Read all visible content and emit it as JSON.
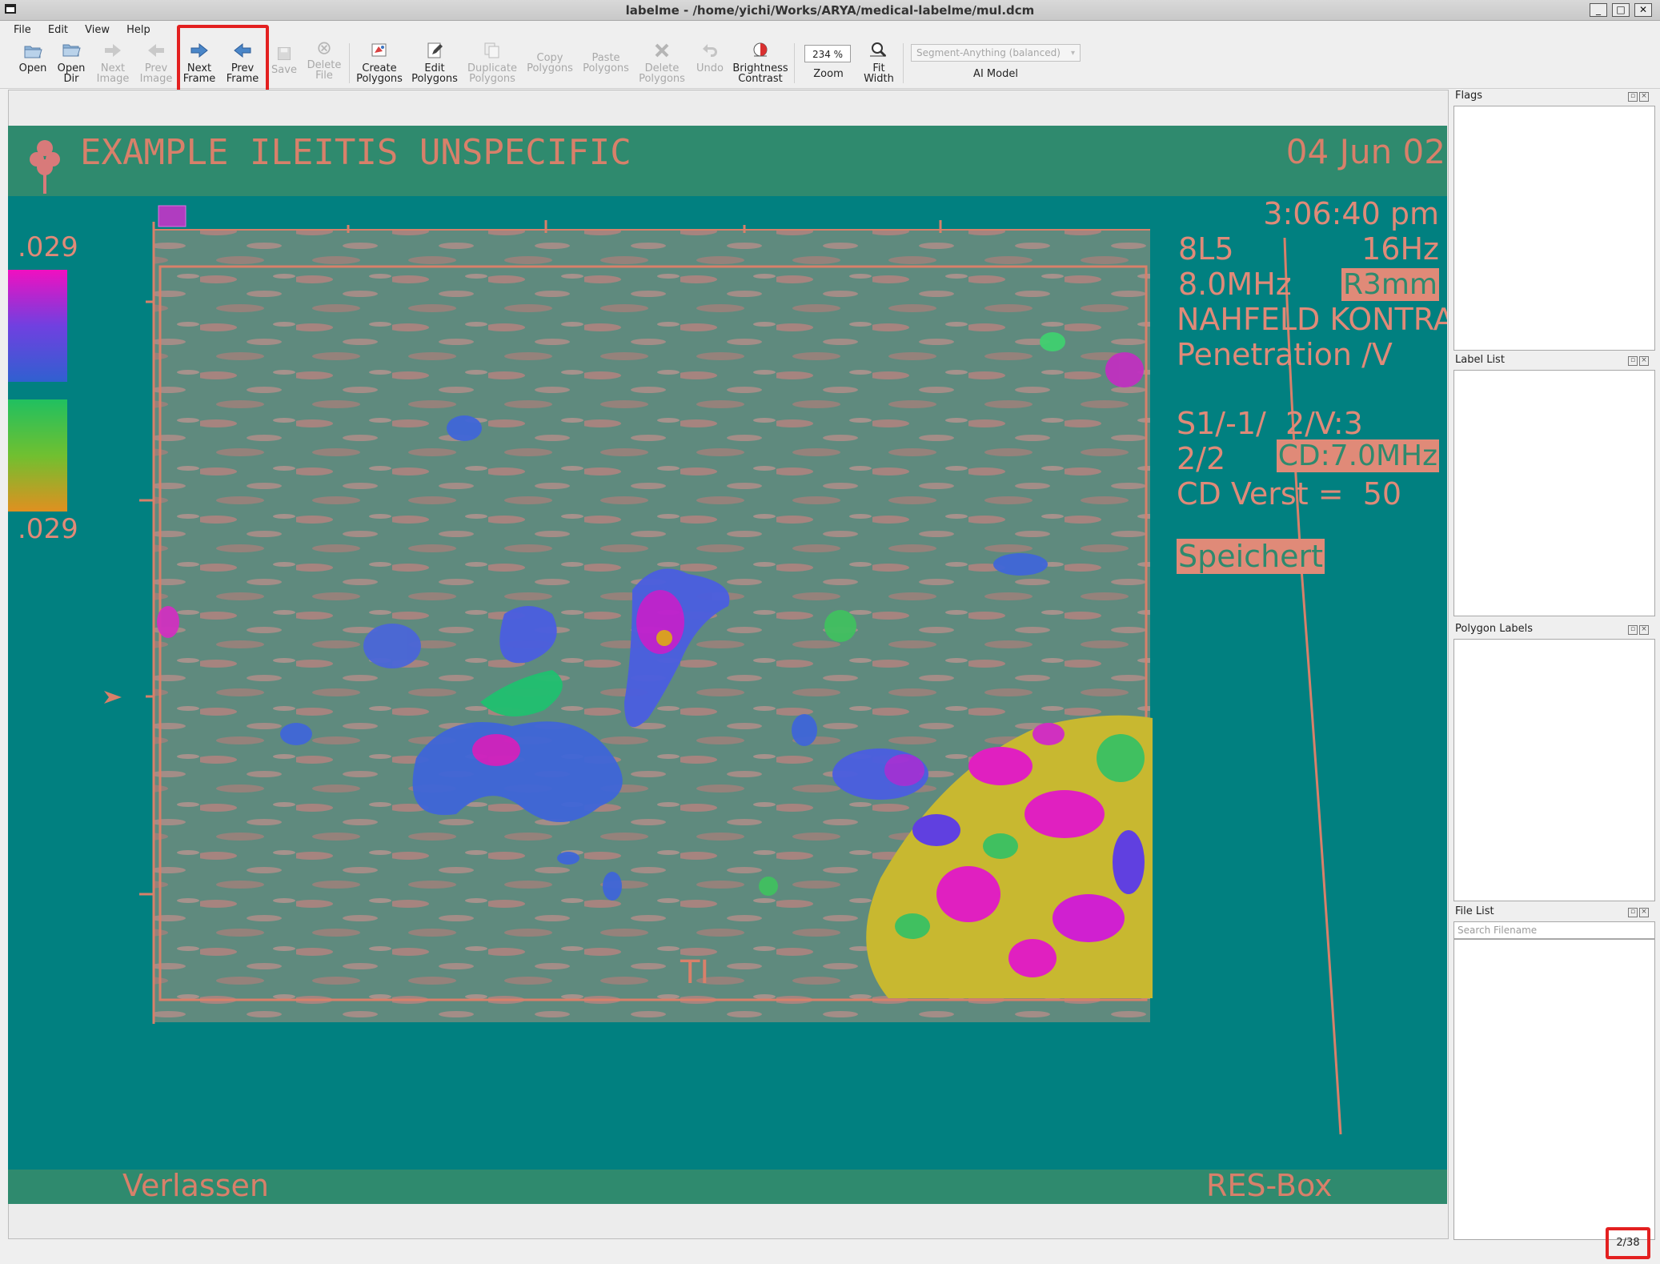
{
  "window": {
    "title": "labelme - /home/yichi/Works/ARYA/medical-labelme/mul.dcm",
    "controls": [
      "_",
      "□",
      "✕"
    ]
  },
  "menu": [
    {
      "label": "File"
    },
    {
      "label": "Edit"
    },
    {
      "label": "View"
    },
    {
      "label": "Help"
    }
  ],
  "toolbar": {
    "open": {
      "line1": "Open",
      "line2": ""
    },
    "open_dir": {
      "line1": "Open",
      "line2": "Dir"
    },
    "next_image": {
      "line1": "Next",
      "line2": "Image"
    },
    "prev_image": {
      "line1": "Prev",
      "line2": "Image"
    },
    "next_frame": {
      "line1": "Next",
      "line2": "Frame"
    },
    "prev_frame": {
      "line1": "Prev",
      "line2": "Frame"
    },
    "save": {
      "line1": "Save",
      "line2": ""
    },
    "delete_file": {
      "line1": "Delete",
      "line2": "File"
    },
    "create_polygons": {
      "line1": "Create",
      "line2": "Polygons"
    },
    "edit_polygons": {
      "line1": "Edit",
      "line2": "Polygons"
    },
    "duplicate_polygons": {
      "line1": "Duplicate",
      "line2": "Polygons"
    },
    "copy_polygons": {
      "line1": "Copy",
      "line2": "Polygons"
    },
    "paste_polygons": {
      "line1": "Paste",
      "line2": "Polygons"
    },
    "delete_polygons": {
      "line1": "Delete",
      "line2": "Polygons"
    },
    "undo": {
      "line1": "Undo",
      "line2": ""
    },
    "brightness_contrast": {
      "line1": "Brightness",
      "line2": "Contrast"
    },
    "zoom_value": "234 %",
    "zoom_label": "Zoom",
    "fit_width": {
      "line1": "Fit",
      "line2": "Width"
    },
    "ai_model_value": "Segment-Anything (balanced)",
    "ai_model_label": "AI Model"
  },
  "image_overlay": {
    "header": "EXAMPLE ILEITIS UNSPECIFIC",
    "date": "04 Jun 02",
    "time": "3:06:40 pm",
    "scale_top": ".029",
    "scale_bottom": ".029",
    "probe": "8L5",
    "rate": "16Hz",
    "freq": "8.0MHz",
    "res": "R3mm",
    "mode1": "NAHFELD KONTRAST",
    "mode2": "Penetration /V",
    "s_line": "S1/-1/  2/V:3",
    "frac": "2/2",
    "cd": "CD:7.0MHz",
    "cd_verst": "CD Verst =  50",
    "saved": "Speichert",
    "ti": "TI",
    "exit": "Verlassen",
    "resbox": "RES-Box"
  },
  "docks": {
    "flags": "Flags",
    "label_list": "Label List",
    "polygon_labels": "Polygon Labels",
    "file_list": "File List",
    "search_placeholder": "Search Filename"
  },
  "status": {
    "counter": "2/38"
  }
}
